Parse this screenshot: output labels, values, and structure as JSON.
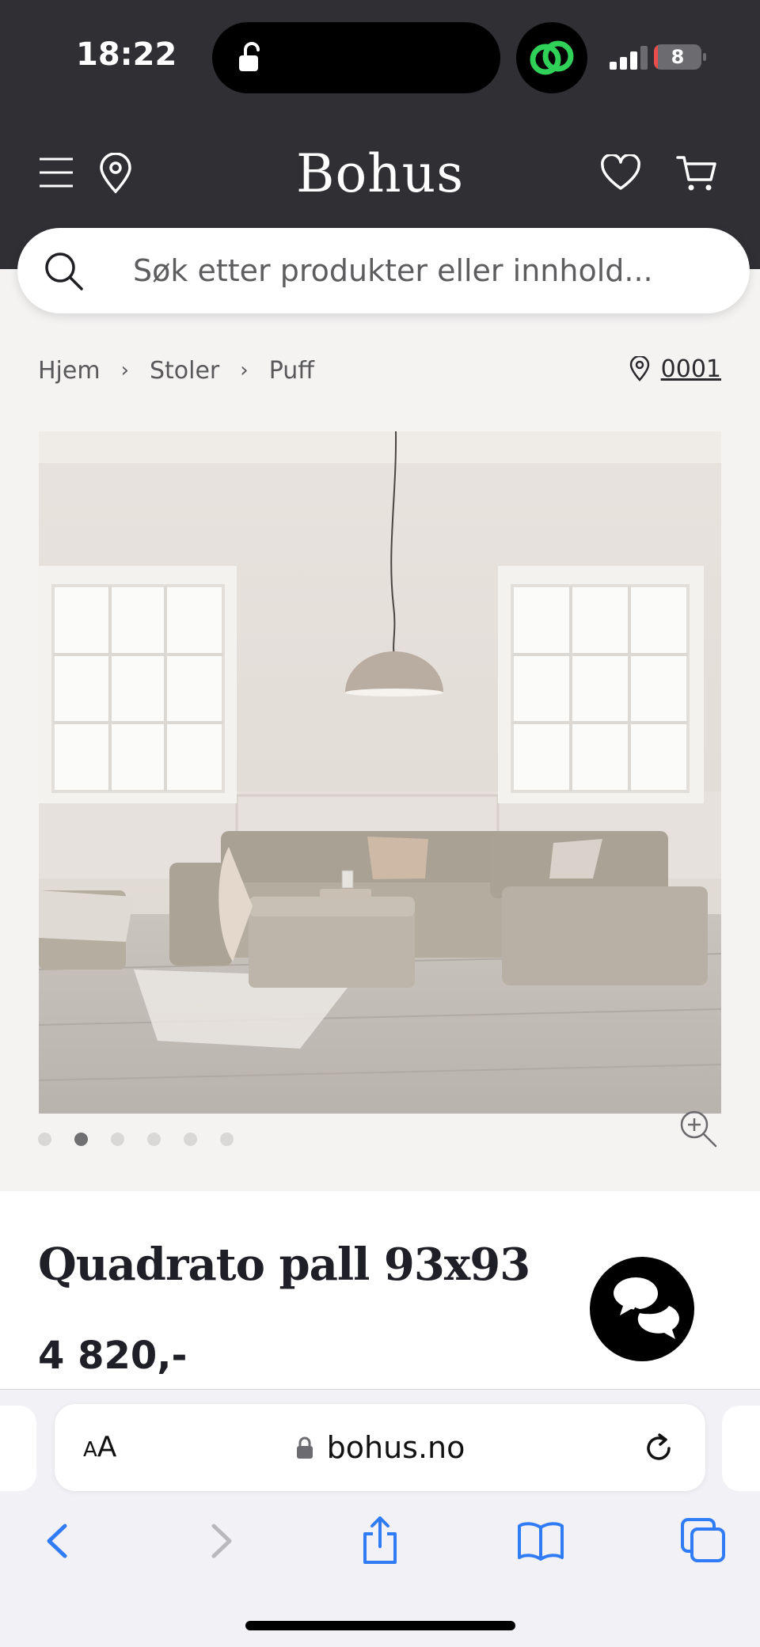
{
  "status_bar": {
    "time": "18:22",
    "battery_level": "8",
    "battery_fraction": 0.08
  },
  "header": {
    "logo": "Bohus",
    "icons": [
      "menu-icon",
      "location-pin-icon",
      "heart-icon",
      "cart-icon"
    ]
  },
  "search": {
    "placeholder": "Søk etter produkter eller innhold..."
  },
  "breadcrumb": {
    "items": [
      "Hjem",
      "Stoler",
      "Puff"
    ],
    "separator": "›",
    "store": "0001"
  },
  "gallery": {
    "dot_count": 6,
    "active_index": 1
  },
  "product": {
    "title": "Quadrato pall 93x93",
    "price": "4 820,-"
  },
  "browser": {
    "text_size_label_small": "A",
    "text_size_label_large": "A",
    "url": "bohus.no"
  },
  "colors": {
    "header_bg": "#2f2f34",
    "page_bg": "#f4f3f2",
    "safari_blue": "#2f7cf6",
    "battery_red": "#ea4c4c",
    "extension_green": "#30d158"
  }
}
